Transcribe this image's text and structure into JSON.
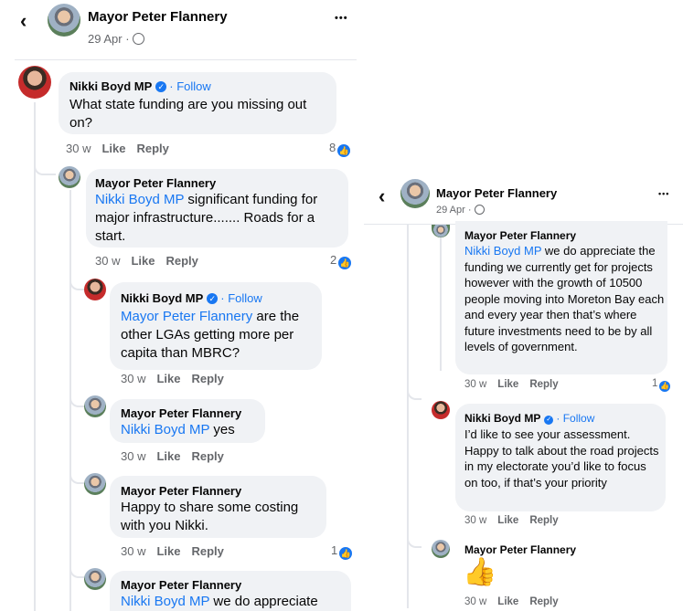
{
  "left_panel": {
    "header": {
      "back_icon": "‹",
      "author": "Mayor Peter Flannery",
      "date": "29 Apr ·",
      "more_icon": "•••"
    },
    "comments": [
      {
        "author": "Nikki Boyd MP",
        "follow": "· Follow",
        "text": "What state funding are you missing out on?",
        "time": "30 w",
        "like": "Like",
        "reply": "Reply",
        "reactions": "8"
      },
      {
        "author": "Mayor Peter Flannery",
        "mention": "Nikki Boyd MP",
        "text": " significant funding for major infrastructure....... Roads for a start.",
        "time": "30 w",
        "like": "Like",
        "reply": "Reply",
        "reactions": "2"
      },
      {
        "author": "Nikki Boyd MP",
        "follow": "· Follow",
        "mention": "Mayor Peter Flannery",
        "text": " are the other LGAs getting more per capita than MBRC?",
        "time": "30 w",
        "like": "Like",
        "reply": "Reply"
      },
      {
        "author": "Mayor Peter Flannery",
        "mention": "Nikki Boyd MP",
        "text": " yes",
        "time": "30 w",
        "like": "Like",
        "reply": "Reply"
      },
      {
        "author": "Mayor Peter Flannery",
        "text": "Happy to share some costing with you Nikki.",
        "time": "30 w",
        "like": "Like",
        "reply": "Reply",
        "reactions": "1"
      },
      {
        "author": "Mayor Peter Flannery",
        "mention": "Nikki Boyd MP",
        "text": " we do appreciate"
      }
    ]
  },
  "right_panel": {
    "header": {
      "back_icon": "‹",
      "author": "Mayor Peter Flannery",
      "date": "29 Apr ·",
      "more_icon": "•••"
    },
    "comments": [
      {
        "author": "Mayor Peter Flannery",
        "mention": "Nikki Boyd MP",
        "text": " we do appreciate the funding we currently get for projects however with the growth of 10500 people moving into Moreton Bay each and every year then that’s where future investments need to be by all levels of government.",
        "time": "30 w",
        "like": "Like",
        "reply": "Reply",
        "reactions": "1"
      },
      {
        "author": "Nikki Boyd MP",
        "follow": "· Follow",
        "text": "I’d like to see your assessment. Happy to talk about the road projects in my electorate you’d like to focus on too, if that’s your priority",
        "time": "30 w",
        "like": "Like",
        "reply": "Reply"
      },
      {
        "author": "Mayor Peter Flannery",
        "sticker": "👍",
        "time": "30 w",
        "like": "Like",
        "reply": "Reply"
      }
    ]
  },
  "icons": {
    "verified": "verified-badge-icon",
    "globe": "globe-icon",
    "reaction": "like-reaction-icon"
  },
  "colors": {
    "link": "#1877f2",
    "bubble": "#f0f2f5",
    "meta": "#65676b"
  }
}
